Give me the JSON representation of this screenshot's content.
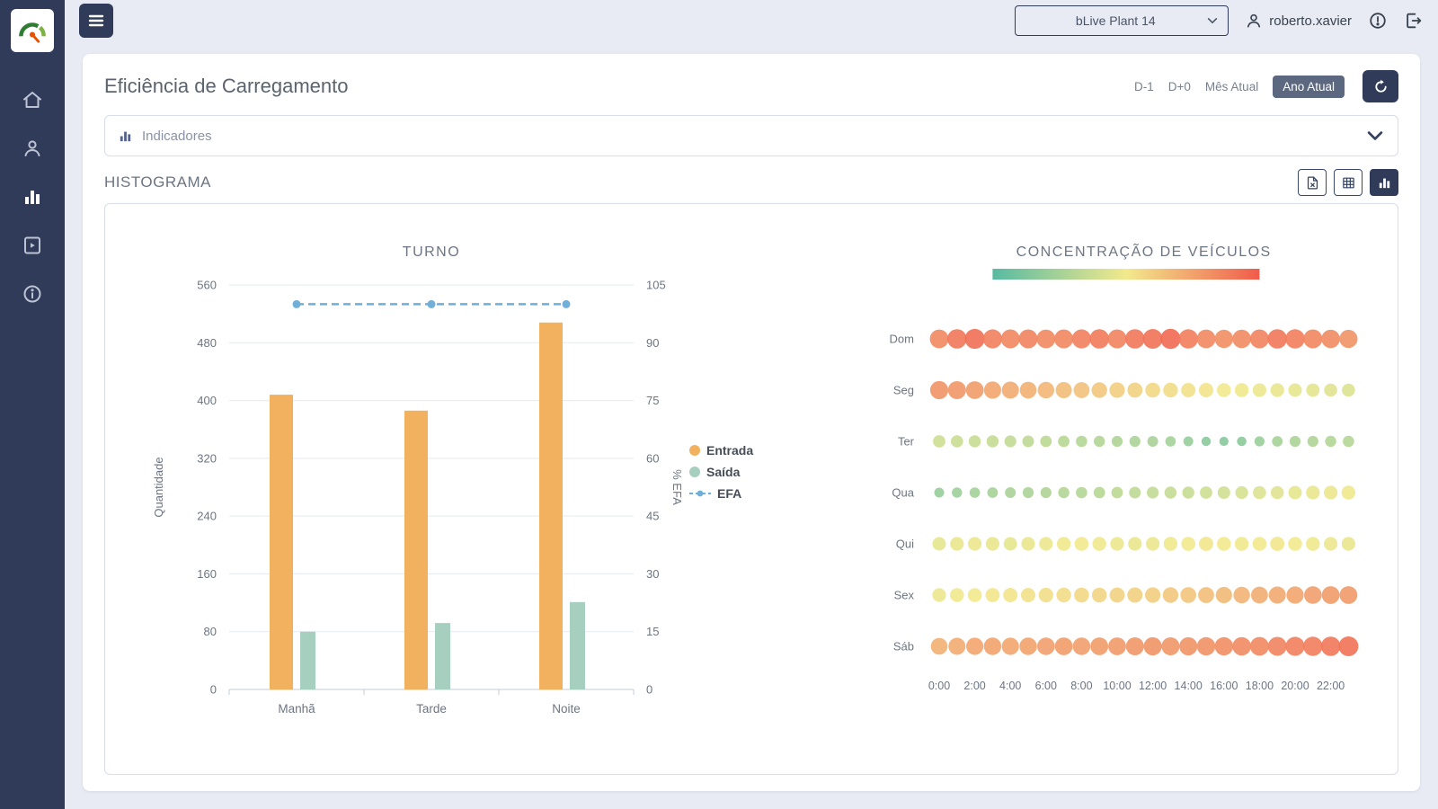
{
  "topbar": {
    "plant_selector": {
      "value": "bLive Plant 14"
    },
    "user": {
      "name": "roberto.xavier"
    }
  },
  "sidebar": {
    "items": [
      {
        "id": "home"
      },
      {
        "id": "user"
      },
      {
        "id": "charts",
        "active": true
      },
      {
        "id": "media"
      },
      {
        "id": "info"
      }
    ]
  },
  "page": {
    "title": "Eficiência de Carregamento",
    "filters": [
      {
        "label": "D-1",
        "active": false
      },
      {
        "label": "D+0",
        "active": false
      },
      {
        "label": "Mês Atual",
        "active": false
      },
      {
        "label": "Ano Atual",
        "active": true
      }
    ],
    "indicators": {
      "label": "Indicadores"
    },
    "section": {
      "title": "HISTOGRAMA"
    }
  },
  "colors": {
    "navy": "#2F3B59",
    "active_badge": "#5C6880",
    "entrada": "#F2B15F",
    "saida": "#A7CFC0",
    "efa": "#6FAFD8",
    "border": "#D9DDE9"
  },
  "chart_data": [
    {
      "type": "bar",
      "title": "TURNO",
      "categories": [
        "Manhã",
        "Tarde",
        "Noite"
      ],
      "series": [
        {
          "name": "Entrada",
          "type": "bar",
          "color": "#F2B15F",
          "values": [
            408,
            386,
            508
          ]
        },
        {
          "name": "Saída",
          "type": "bar",
          "color": "#A7CFC0",
          "values": [
            80,
            92,
            121
          ]
        },
        {
          "name": "EFA",
          "type": "line",
          "color": "#6FAFD8",
          "axis": "right",
          "values": [
            100,
            100,
            100
          ]
        }
      ],
      "ylabel_left": "Quantidade",
      "ylabel_right": "% EFA",
      "ylim_left": [
        0,
        560
      ],
      "yticks_left": [
        0,
        80,
        160,
        240,
        320,
        400,
        480,
        560
      ],
      "ylim_right": [
        0,
        105
      ],
      "yticks_right": [
        0,
        15,
        30,
        45,
        60,
        75,
        90,
        105
      ],
      "legend_position": "right",
      "grid": true
    },
    {
      "type": "heatmap",
      "title": "CONCENTRAÇÃO DE VEÍCULOS",
      "rows": [
        "Dom",
        "Seg",
        "Ter",
        "Qua",
        "Qui",
        "Sex",
        "Sáb"
      ],
      "hours": 24,
      "x_labels": [
        "0:00",
        "2:00",
        "4:00",
        "6:00",
        "8:00",
        "10:00",
        "12:00",
        "14:00",
        "16:00",
        "18:00",
        "20:00",
        "22:00"
      ],
      "gradient": [
        "#58BAA2",
        "#F2E98C",
        "#F15B4C"
      ],
      "values": [
        [
          0.84,
          0.9,
          0.93,
          0.87,
          0.85,
          0.86,
          0.84,
          0.85,
          0.87,
          0.89,
          0.86,
          0.9,
          0.92,
          0.95,
          0.88,
          0.84,
          0.82,
          0.83,
          0.86,
          0.9,
          0.88,
          0.85,
          0.83,
          0.8
        ],
        [
          0.8,
          0.79,
          0.77,
          0.74,
          0.72,
          0.7,
          0.68,
          0.66,
          0.64,
          0.62,
          0.6,
          0.58,
          0.56,
          0.55,
          0.53,
          0.52,
          0.5,
          0.49,
          0.48,
          0.47,
          0.46,
          0.45,
          0.44,
          0.43
        ],
        [
          0.38,
          0.37,
          0.36,
          0.35,
          0.34,
          0.33,
          0.32,
          0.31,
          0.3,
          0.29,
          0.28,
          0.27,
          0.26,
          0.24,
          0.2,
          0.16,
          0.15,
          0.17,
          0.21,
          0.25,
          0.27,
          0.28,
          0.29,
          0.3
        ],
        [
          0.2,
          0.22,
          0.24,
          0.25,
          0.26,
          0.27,
          0.28,
          0.29,
          0.3,
          0.31,
          0.32,
          0.33,
          0.34,
          0.35,
          0.36,
          0.38,
          0.39,
          0.41,
          0.43,
          0.44,
          0.46,
          0.47,
          0.48,
          0.49
        ],
        [
          0.46,
          0.47,
          0.48,
          0.47,
          0.46,
          0.47,
          0.48,
          0.49,
          0.5,
          0.49,
          0.48,
          0.47,
          0.48,
          0.49,
          0.5,
          0.51,
          0.5,
          0.49,
          0.5,
          0.51,
          0.5,
          0.49,
          0.48,
          0.47
        ],
        [
          0.48,
          0.49,
          0.5,
          0.51,
          0.52,
          0.53,
          0.54,
          0.55,
          0.56,
          0.57,
          0.58,
          0.59,
          0.6,
          0.62,
          0.63,
          0.65,
          0.67,
          0.69,
          0.71,
          0.73,
          0.74,
          0.76,
          0.77,
          0.78
        ],
        [
          0.7,
          0.72,
          0.74,
          0.75,
          0.74,
          0.75,
          0.76,
          0.77,
          0.76,
          0.77,
          0.78,
          0.79,
          0.8,
          0.79,
          0.8,
          0.81,
          0.82,
          0.83,
          0.84,
          0.86,
          0.87,
          0.88,
          0.9,
          0.92
        ]
      ]
    }
  ]
}
